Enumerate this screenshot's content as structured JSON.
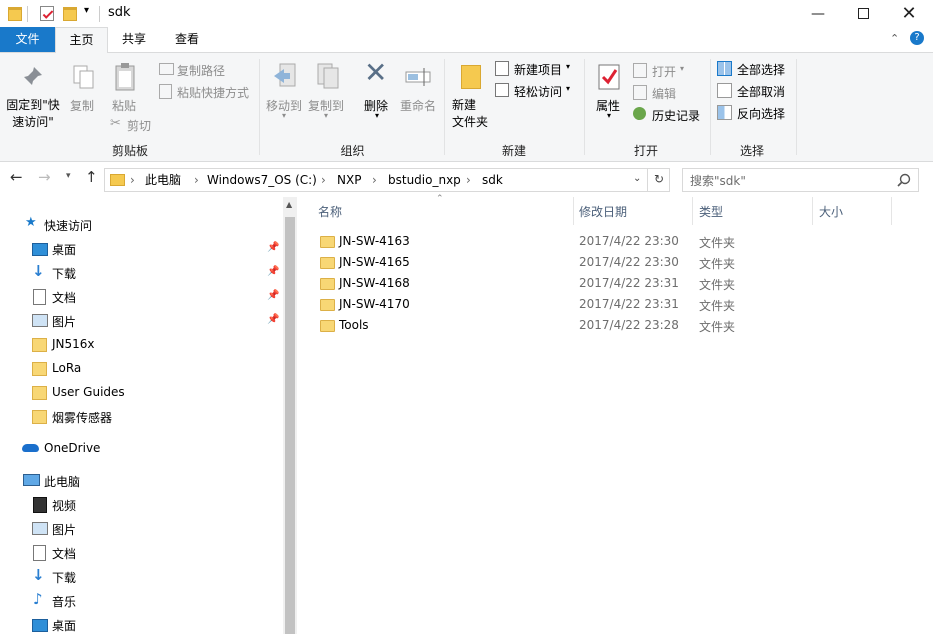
{
  "window": {
    "title": "sdk"
  },
  "tabs": [
    {
      "label": "文件"
    },
    {
      "label": "主页"
    },
    {
      "label": "共享"
    },
    {
      "label": "查看"
    }
  ],
  "ribbon": {
    "clipboard": {
      "pin_quick": "固定到\"快速访问\"",
      "copy": "复制",
      "paste": "粘贴",
      "copy_path": "复制路径",
      "paste_shortcut": "粘贴快捷方式",
      "cut": "剪切",
      "group": "剪贴板"
    },
    "organize": {
      "move_to": "移动到",
      "copy_to": "复制到",
      "delete": "删除",
      "rename": "重命名",
      "group": "组织"
    },
    "new": {
      "new_folder": "新建\n文件夹",
      "new_item": "新建项目",
      "easy_access": "轻松访问",
      "group": "新建"
    },
    "open": {
      "properties": "属性",
      "open": "打开",
      "edit": "编辑",
      "history": "历史记录",
      "group": "打开"
    },
    "select": {
      "select_all": "全部选择",
      "select_none": "全部取消",
      "invert": "反向选择",
      "group": "选择"
    }
  },
  "address": {
    "breadcrumbs": [
      "此电脑",
      "Windows7_OS (C:)",
      "NXP",
      "bstudio_nxp",
      "sdk"
    ],
    "search_placeholder": "搜索\"sdk\""
  },
  "nav": {
    "quick_access": "快速访问",
    "quick_items": [
      {
        "label": "桌面",
        "pinned": true
      },
      {
        "label": "下载",
        "pinned": true
      },
      {
        "label": "文档",
        "pinned": true
      },
      {
        "label": "图片",
        "pinned": true
      },
      {
        "label": "JN516x"
      },
      {
        "label": "LoRa"
      },
      {
        "label": "User Guides"
      },
      {
        "label": "烟雾传感器"
      }
    ],
    "onedrive": "OneDrive",
    "this_pc": "此电脑",
    "pc_items": [
      {
        "label": "视频"
      },
      {
        "label": "图片"
      },
      {
        "label": "文档"
      },
      {
        "label": "下载"
      },
      {
        "label": "音乐"
      },
      {
        "label": "桌面"
      }
    ]
  },
  "columns": {
    "name": "名称",
    "modified": "修改日期",
    "type": "类型",
    "size": "大小"
  },
  "files": [
    {
      "name": "JN-SW-4163",
      "modified": "2017/4/22 23:30",
      "type": "文件夹"
    },
    {
      "name": "JN-SW-4165",
      "modified": "2017/4/22 23:30",
      "type": "文件夹"
    },
    {
      "name": "JN-SW-4168",
      "modified": "2017/4/22 23:31",
      "type": "文件夹"
    },
    {
      "name": "JN-SW-4170",
      "modified": "2017/4/22 23:31",
      "type": "文件夹"
    },
    {
      "name": "Tools",
      "modified": "2017/4/22 23:28",
      "type": "文件夹"
    }
  ],
  "colors": {
    "accent": "#1979ca",
    "folder": "#f8d775",
    "header_text": "#4c607a"
  }
}
